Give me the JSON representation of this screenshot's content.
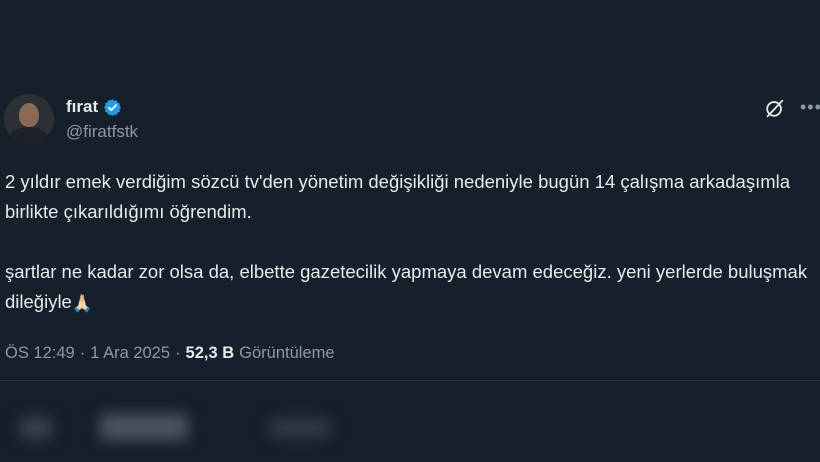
{
  "user": {
    "display_name": "fırat",
    "handle": "@firatfstk",
    "verified": true,
    "avatar": "profile-photo"
  },
  "tweet": {
    "paragraph1": "2 yıldır emek verdiğim sözcü tv'den yönetim değişikliği nedeniyle bugün 14 çalışma arkadaşımla birlikte çıkarıldığımı öğrendim.",
    "paragraph2": "şartlar ne kadar zor olsa da, elbette gazetecilik yapmaya devam edeceğiz. yeni yerlerde buluşmak dileğiyle",
    "emoji": "🙏🏻"
  },
  "meta": {
    "time": "ÖS 12:49",
    "separator": "·",
    "date": "1 Ara 2025",
    "views_count": "52,3 B",
    "views_label": "Görüntüleme"
  },
  "icons": {
    "grok": "grok-icon",
    "more": "more-icon",
    "verified": "verified-badge-icon"
  },
  "colors": {
    "background": "#15202b",
    "text": "#e7e9ea",
    "secondary": "#8b98a5",
    "verified": "#1d9bf0"
  }
}
